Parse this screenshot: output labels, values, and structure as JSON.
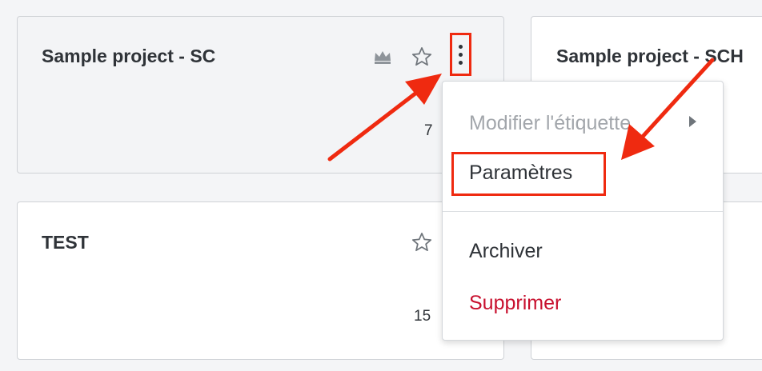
{
  "colors": {
    "annotation": "#ef2a10",
    "danger": "#c8102e",
    "text": "#2f3338",
    "muted": "#a2a6ab"
  },
  "cards": [
    {
      "title": "Sample project - SC",
      "count": "7",
      "icons": [
        "crown-icon",
        "star-outline-icon",
        "more-vertical-icon"
      ]
    },
    {
      "title": "Sample project - SCH"
    },
    {
      "title": "TEST",
      "count": "15",
      "icons": [
        "star-outline-icon"
      ]
    }
  ],
  "menu": {
    "items": [
      {
        "label": "Modifier l'étiquette",
        "state": "disabled",
        "has_submenu": true
      },
      {
        "label": "Paramètres",
        "state": "normal"
      },
      {
        "label": "Archiver",
        "state": "normal"
      },
      {
        "label": "Supprimer",
        "state": "danger"
      }
    ]
  }
}
